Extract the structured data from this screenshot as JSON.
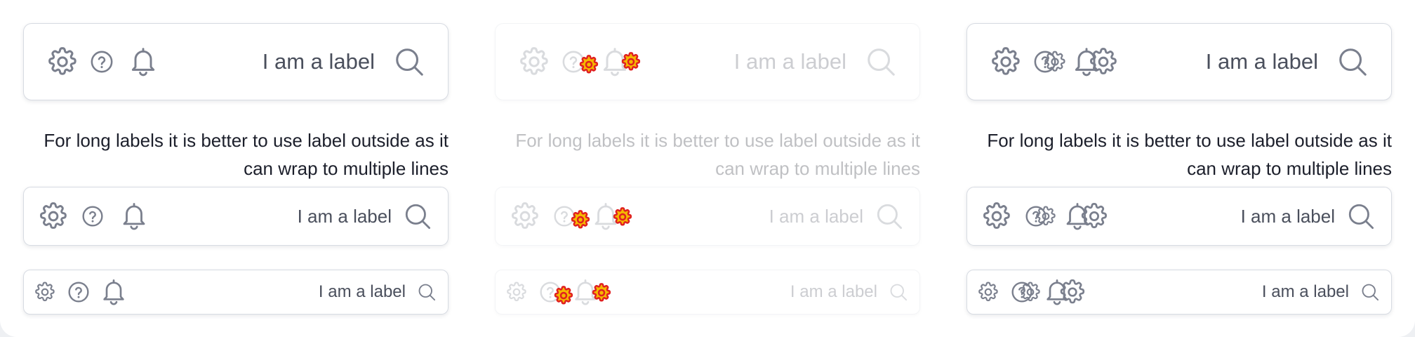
{
  "icon_names": {
    "settings": "gear-icon",
    "help": "help-circle-icon",
    "notifications": "bell-icon",
    "search": "search-icon",
    "badge": "gear-badge-icon"
  },
  "colors": {
    "icon": "#7a7f8d",
    "label": "#4a4f5c",
    "caption": "#1c1f2b",
    "border": "#d7dbe2",
    "warning_badge_fill": "#f5b800",
    "warning_badge_stroke": "#e02020"
  },
  "panels": [
    {
      "state": "default",
      "fields": {
        "large_label": "I am a label",
        "medium_label": "I am a label",
        "small_label": "I am a label"
      },
      "caption": "For long labels it is better to use label outside as it can wrap to multiple lines"
    },
    {
      "state": "disabled",
      "fields": {
        "large_label": "I am a label",
        "medium_label": "I am a label",
        "small_label": "I am a label"
      },
      "caption": "For long labels it is better to use label outside as it can wrap to multiple lines"
    },
    {
      "state": "badged",
      "fields": {
        "large_label": "I am a label",
        "medium_label": "I am a label",
        "small_label": "I am a label"
      },
      "caption": "For long labels it is better to use label outside as it can wrap to multiple lines"
    }
  ]
}
